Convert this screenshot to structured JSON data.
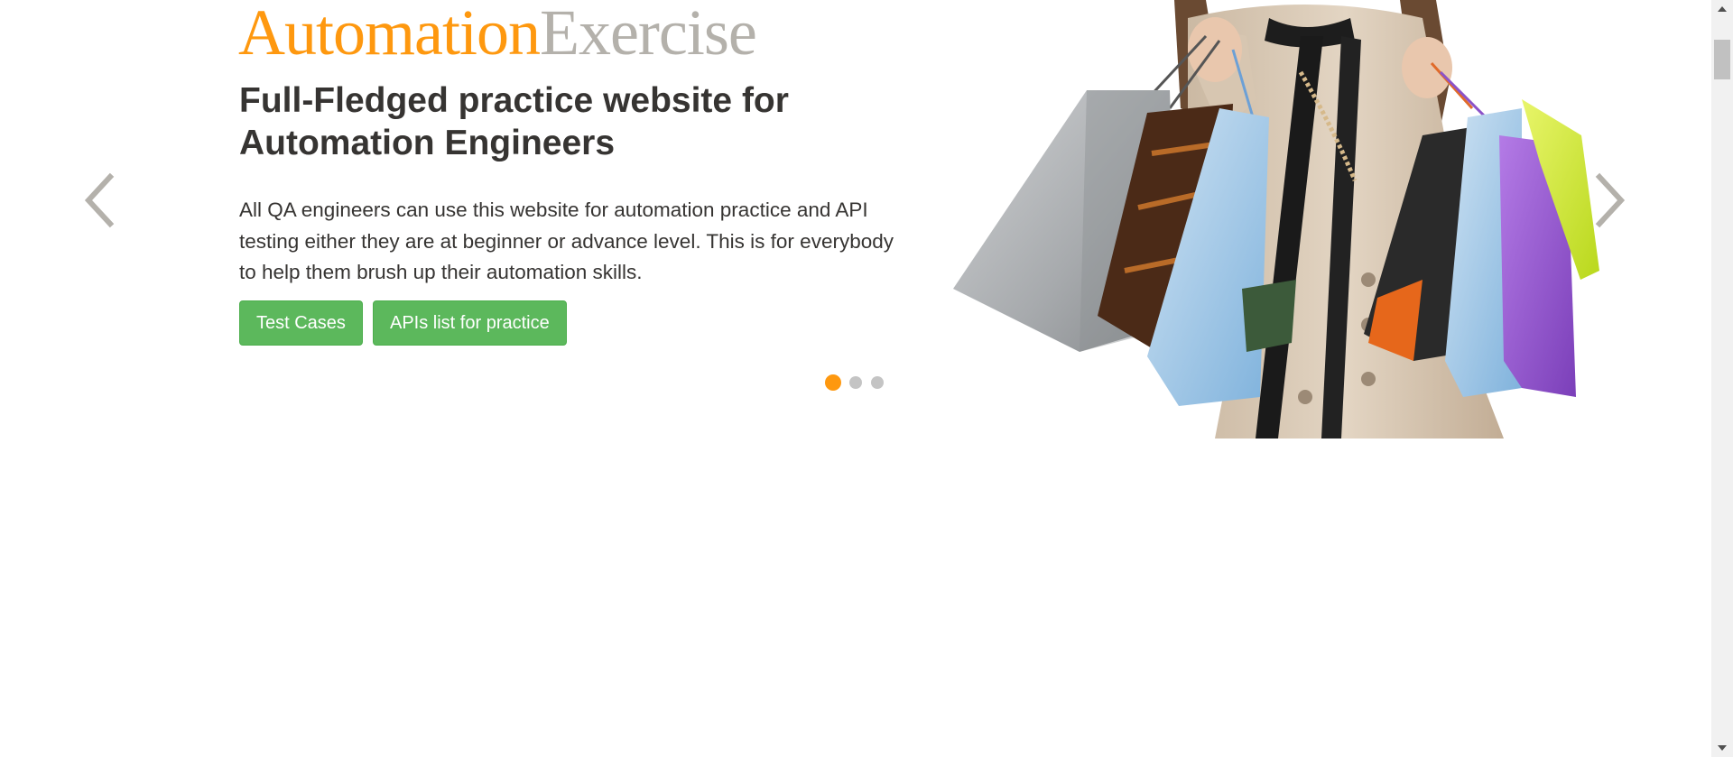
{
  "slider": {
    "brand": {
      "part1": "Automation",
      "part2": "Exercise"
    },
    "headline": "Full-Fledged practice website for Automation Engineers",
    "description": "All QA engineers can use this website for automation practice and API testing either they are at beginner or advance level. This is for everybody to help them brush up their automation skills.",
    "buttons": {
      "test_cases": "Test Cases",
      "apis_list": "APIs list for practice"
    },
    "indicators": {
      "count": 3,
      "active_index": 0
    },
    "prev_icon": "chevron-left-icon",
    "next_icon": "chevron-right-icon"
  },
  "colors": {
    "brand_orange": "#fe980f",
    "brand_grey": "#b4b1ab",
    "button_green": "#5cb85c",
    "text_dark": "#363432"
  }
}
